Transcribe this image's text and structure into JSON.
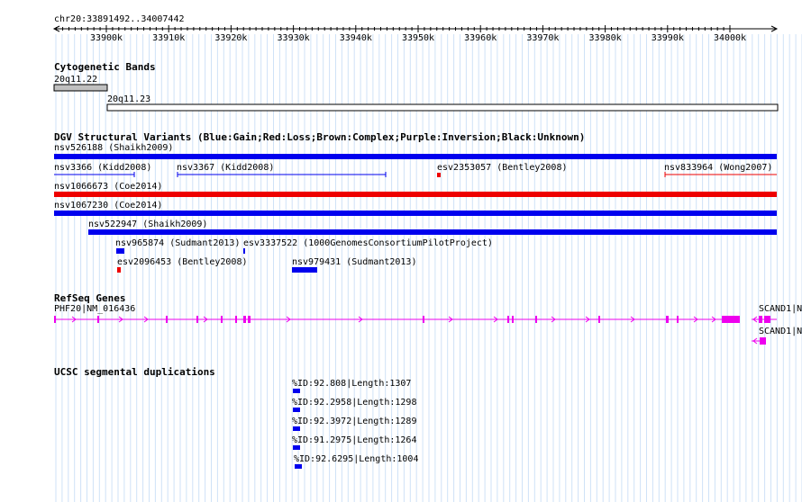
{
  "ruler": {
    "position": "chr20:33891492..34007442",
    "ticks": [
      "33900k",
      "33910k",
      "33920k",
      "33930k",
      "33940k",
      "33950k",
      "33960k",
      "33970k",
      "33980k",
      "33990k",
      "34000k"
    ]
  },
  "cytobands": {
    "title": "Cytogenetic Bands",
    "bands": [
      {
        "name": "20q11.22"
      },
      {
        "name": "20q11.23"
      }
    ]
  },
  "dgv": {
    "title": "DGV Structural Variants (Blue:Gain;Red:Loss;Brown:Complex;Purple:Inversion;Black:Unknown)",
    "colors": {
      "gain": "#0000ee",
      "loss": "#ee0000"
    },
    "variants": [
      {
        "label": "nsv526188 (Shaikh2009)",
        "type": "gain"
      },
      {
        "label": "nsv3366 (Kidd2008)",
        "type": "gain"
      },
      {
        "label": "nsv3367 (Kidd2008)",
        "type": "gain"
      },
      {
        "label": "esv2353057 (Bentley2008)",
        "type": "loss"
      },
      {
        "label": "nsv833964 (Wong2007)",
        "type": "loss"
      },
      {
        "label": "nsv1066673 (Coe2014)",
        "type": "loss"
      },
      {
        "label": "nsv1067230 (Coe2014)",
        "type": "gain"
      },
      {
        "label": "nsv522947 (Shaikh2009)",
        "type": "gain"
      },
      {
        "label": "nsv965874 (Sudmant2013)",
        "type": "gain"
      },
      {
        "label": "esv3337522 (1000GenomesConsortiumPilotProject)",
        "type": "gain"
      },
      {
        "label": "esv2096453 (Bentley2008)",
        "type": "loss"
      },
      {
        "label": "nsv979431 (Sudmant2013)",
        "type": "gain"
      }
    ]
  },
  "refseq": {
    "title": "RefSeq Genes",
    "color": "#ee00ee",
    "genes": [
      {
        "label": "PHF20|NM_016436"
      },
      {
        "label": "SCAND1|N"
      },
      {
        "label": "SCAND1|N"
      }
    ]
  },
  "segdups": {
    "title": "UCSC segmental duplications",
    "color": "#0000ee",
    "items": [
      {
        "label": "%ID:92.808|Length:1307"
      },
      {
        "label": "%ID:92.2958|Length:1298"
      },
      {
        "label": "%ID:92.3972|Length:1289"
      },
      {
        "label": "%ID:91.2975|Length:1264"
      },
      {
        "label": "%ID:92.6295|Length:1004"
      }
    ]
  }
}
